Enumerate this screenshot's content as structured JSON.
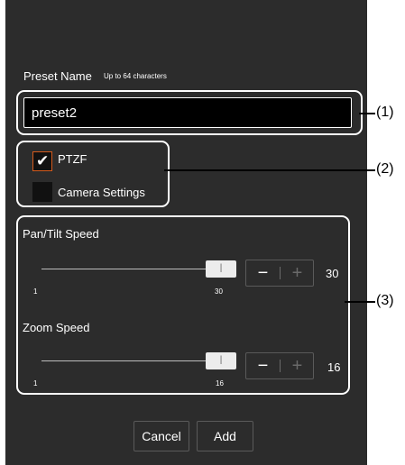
{
  "preset_name": {
    "label": "Preset Name",
    "hint": "Up to 64 characters",
    "value": "preset2"
  },
  "options": {
    "ptzf_label": "PTZF",
    "ptzf_checked": true,
    "camera_settings_label": "Camera Settings",
    "camera_settings_checked": false
  },
  "pan_tilt": {
    "title": "Pan/Tilt Speed",
    "min": "1",
    "max": "30",
    "value": "30"
  },
  "zoom": {
    "title": "Zoom Speed",
    "min": "1",
    "max": "16",
    "value": "16"
  },
  "stepper": {
    "minus": "−",
    "plus": "+"
  },
  "buttons": {
    "cancel": "Cancel",
    "add": "Add"
  },
  "callouts": [
    "(1)",
    "(2)",
    "(3)"
  ],
  "colors": {
    "dialog_bg": "#2c2c2c",
    "accent": "#d45a1c",
    "input_bg": "#000000"
  }
}
